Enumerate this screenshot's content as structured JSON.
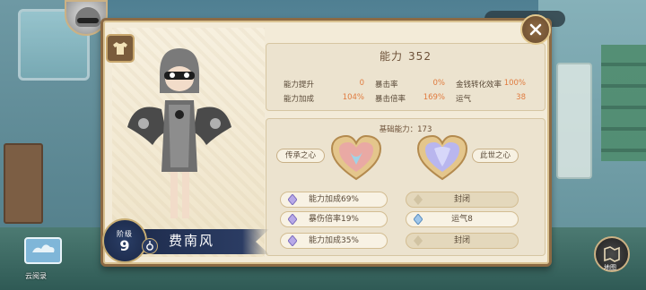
{
  "power": {
    "label": "能力",
    "value": "352"
  },
  "stats": [
    {
      "label": "能力提升",
      "value": "0"
    },
    {
      "label": "暴击率",
      "value": "0%"
    },
    {
      "label": "金钱转化效率",
      "value": "100%"
    },
    {
      "label": "能力加成",
      "value": "104%"
    },
    {
      "label": "暴击倍率",
      "value": "169%"
    },
    {
      "label": "运气",
      "value": "38"
    }
  ],
  "base_power": {
    "label": "基础能力：",
    "value": "173"
  },
  "tags": {
    "inherit": "传承之心",
    "world": "此世之心"
  },
  "slots_left": [
    "能力加成69%",
    "暴伤倍率19%",
    "能力加成35%"
  ],
  "slots_right": [
    "封闭",
    "运气8",
    "封闭"
  ],
  "stage": {
    "label": "阶级",
    "value": "9"
  },
  "character": {
    "name": "费南风"
  },
  "bottom_left": {
    "label": "云阅录"
  },
  "bottom_right": {
    "label": "地图"
  },
  "colors": {
    "accent": "#e07b3f",
    "frame": "#8c6a44",
    "panel": "#f3ebd8"
  }
}
